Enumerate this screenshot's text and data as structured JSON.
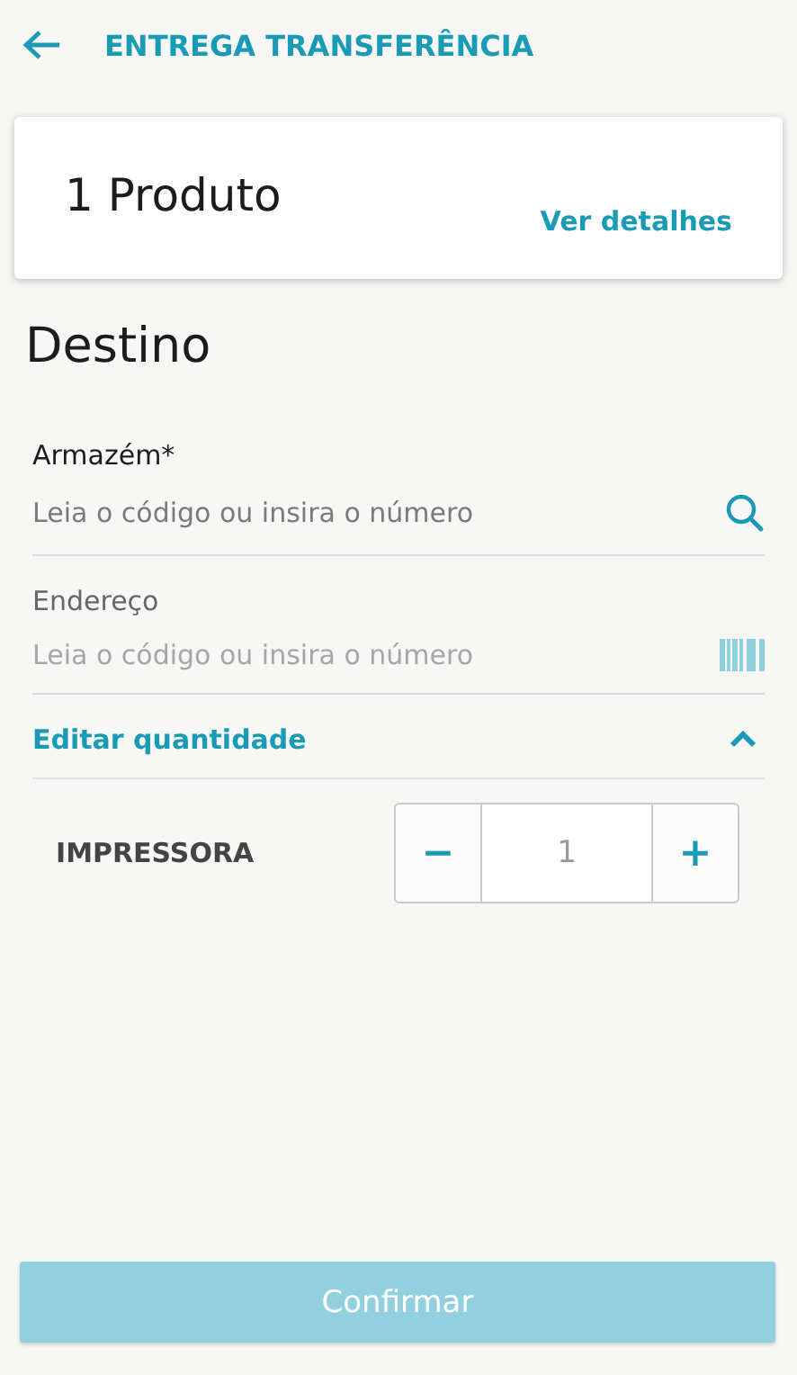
{
  "header": {
    "title": "ENTREGA TRANSFERÊNCIA"
  },
  "summary": {
    "title": "1 Produto",
    "link": "Ver detalhes"
  },
  "section_title": "Destino",
  "fields": [
    {
      "label": "Armazém*",
      "placeholder": "Leia o código ou insira o número",
      "kind": "search",
      "disabled": false
    },
    {
      "label": "Endereço",
      "placeholder": "Leia o código ou insira o número",
      "kind": "barcode",
      "disabled": true
    }
  ],
  "quantity_panel": {
    "title": "Editar quantidade",
    "expanded": true,
    "items": [
      {
        "name": "IMPRESSORA",
        "decrement": "−",
        "value": "1",
        "increment": "+"
      }
    ]
  },
  "confirm_button": {
    "label": "Confirmar",
    "disabled": true
  }
}
